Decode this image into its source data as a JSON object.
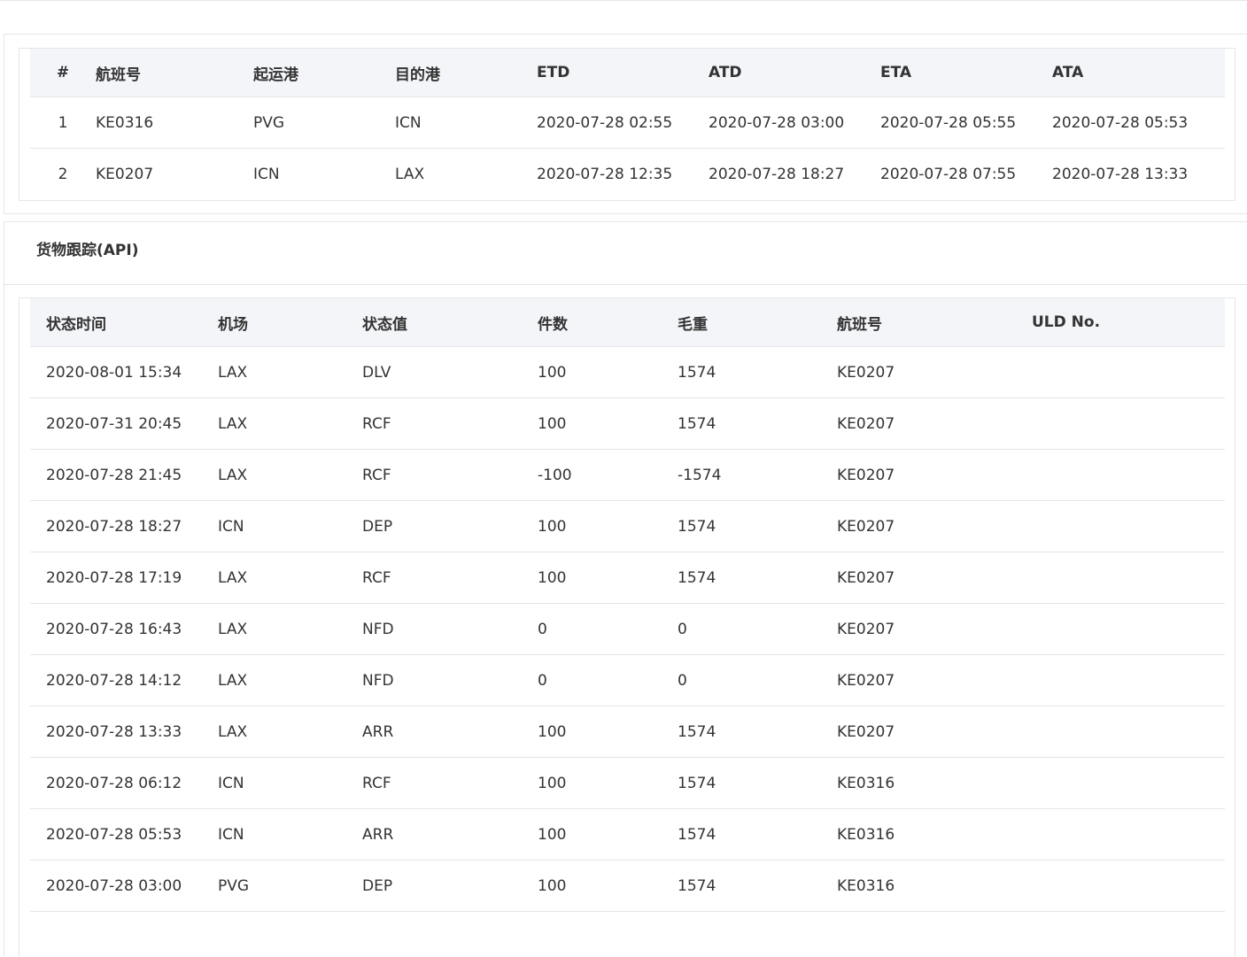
{
  "flights": {
    "columns": [
      "#",
      "航班号",
      "起运港",
      "目的港",
      "ETD",
      "ATD",
      "ETA",
      "ATA"
    ],
    "rows": [
      [
        "1",
        "KE0316",
        "PVG",
        "ICN",
        "2020-07-28 02:55",
        "2020-07-28 03:00",
        "2020-07-28 05:55",
        "2020-07-28 05:53"
      ],
      [
        "2",
        "KE0207",
        "ICN",
        "LAX",
        "2020-07-28 12:35",
        "2020-07-28 18:27",
        "2020-07-28 07:55",
        "2020-07-28 13:33"
      ]
    ]
  },
  "cargo": {
    "title": "货物跟踪(API)",
    "columns": [
      "状态时间",
      "机场",
      "状态值",
      "件数",
      "毛重",
      "航班号",
      "ULD No."
    ],
    "rows": [
      [
        "2020-08-01 15:34",
        "LAX",
        "DLV",
        "100",
        "1574",
        "KE0207",
        ""
      ],
      [
        "2020-07-31 20:45",
        "LAX",
        "RCF",
        "100",
        "1574",
        "KE0207",
        ""
      ],
      [
        "2020-07-28 21:45",
        "LAX",
        "RCF",
        "-100",
        "-1574",
        "KE0207",
        ""
      ],
      [
        "2020-07-28 18:27",
        "ICN",
        "DEP",
        "100",
        "1574",
        "KE0207",
        ""
      ],
      [
        "2020-07-28 17:19",
        "LAX",
        "RCF",
        "100",
        "1574",
        "KE0207",
        ""
      ],
      [
        "2020-07-28 16:43",
        "LAX",
        "NFD",
        "0",
        "0",
        "KE0207",
        ""
      ],
      [
        "2020-07-28 14:12",
        "LAX",
        "NFD",
        "0",
        "0",
        "KE0207",
        ""
      ],
      [
        "2020-07-28 13:33",
        "LAX",
        "ARR",
        "100",
        "1574",
        "KE0207",
        ""
      ],
      [
        "2020-07-28 06:12",
        "ICN",
        "RCF",
        "100",
        "1574",
        "KE0316",
        ""
      ],
      [
        "2020-07-28 05:53",
        "ICN",
        "ARR",
        "100",
        "1574",
        "KE0316",
        ""
      ],
      [
        "2020-07-28 03:00",
        "PVG",
        "DEP",
        "100",
        "1574",
        "KE0316",
        ""
      ]
    ]
  }
}
